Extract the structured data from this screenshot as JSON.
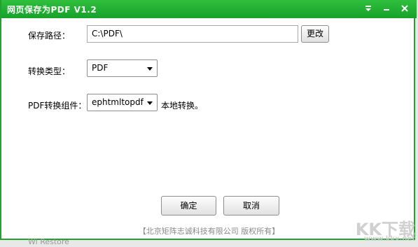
{
  "window": {
    "title": "网页保存为PDF  V1.2",
    "accent_color": "#1fa22e"
  },
  "titlebar_buttons": {
    "menu_icon": "dropdown-arrow-icon",
    "minimize_icon": "minimize-icon",
    "close_icon": "close-icon"
  },
  "save_path": {
    "label": "保存路径：",
    "value": "C:\\PDF\\",
    "change_button": "更改"
  },
  "convert_type": {
    "label": "转换类型：",
    "selected": "PDF"
  },
  "component": {
    "label": "PDF转换组件：",
    "selected": "ephtmltopdf",
    "note": "本地转换。"
  },
  "actions": {
    "ok": "确定",
    "cancel": "取消"
  },
  "footer": {
    "text": "【北京矩阵志诚科技有限公司 版权所有】"
  },
  "watermark": {
    "main": "KK下载",
    "sub": "www.kkx.net"
  },
  "background_peek": {
    "text": "Wi Restore"
  }
}
